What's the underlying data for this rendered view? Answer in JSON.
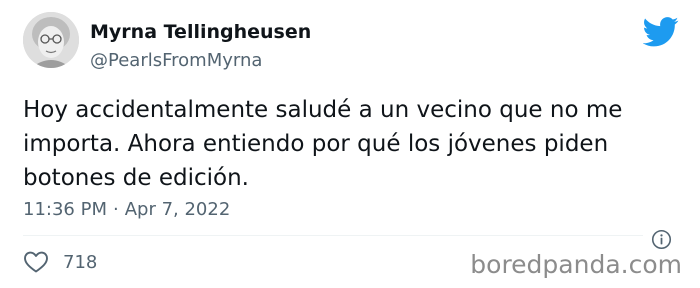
{
  "author": {
    "display_name": "Myrna Tellingheusen",
    "handle": "@PearlsFromMyrna",
    "avatar_icon": "elderly-woman-portrait"
  },
  "tweet": {
    "text": "Hoy accidentalmente saludé a un vecino que no me importa. Ahora entiendo por qué los jóvenes piden botones de edición.",
    "time": "11:36 PM",
    "separator": "·",
    "date": "Apr 7, 2022",
    "like_count": "718"
  },
  "icons": {
    "brand": "twitter-bird-icon",
    "info": "info-icon",
    "like": "heart-icon"
  },
  "colors": {
    "brand_blue": "#1d9bf0",
    "text_primary": "#0f1419",
    "text_secondary": "#536471"
  },
  "watermark": "boredpanda.com"
}
